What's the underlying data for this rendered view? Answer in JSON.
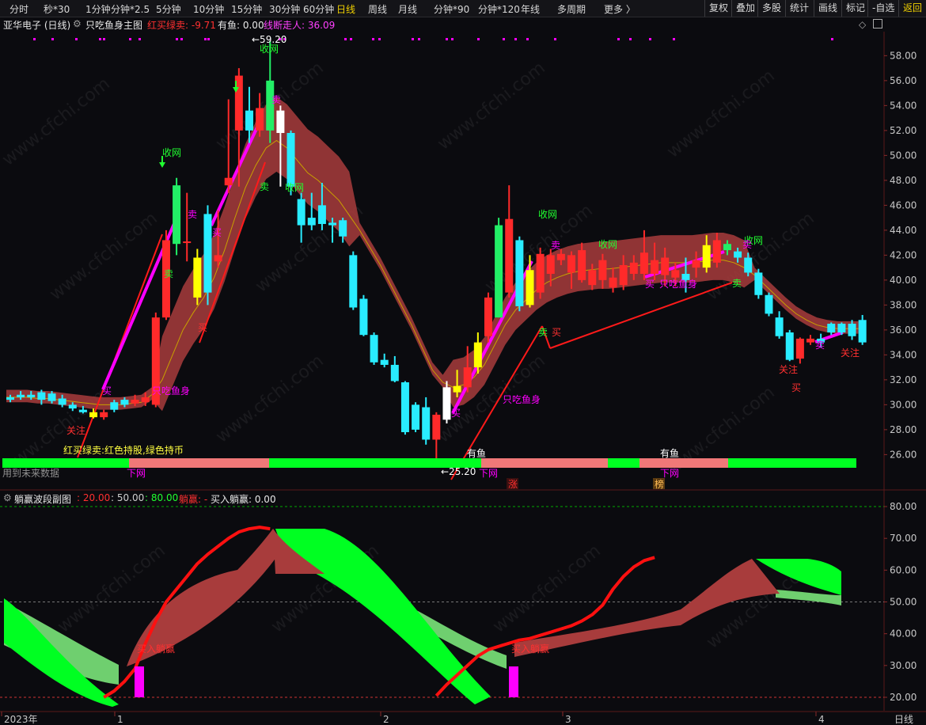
{
  "toolbar": {
    "tabs": [
      "分时",
      "秒*30",
      "1分钟",
      "分钟*2.5",
      "5分钟",
      "10分钟",
      "15分钟",
      "30分钟",
      "60分钟",
      "日线",
      "周线",
      "月线",
      "分钟*90",
      "分钟*120",
      "年线",
      "多周期",
      "更多 〉"
    ],
    "active_tab": "日线",
    "right_buttons": [
      "复权",
      "叠加",
      "多股",
      "统计",
      "画线",
      "标记",
      "-自选",
      "返回"
    ],
    "highlight_button": "返回"
  },
  "main": {
    "stock_title": "亚华电子 (日线)",
    "indicator_name": "只吃鱼身主图",
    "hongmai_label": "红买绿卖: -9.71",
    "youyu_label": "有鱼: 0.00",
    "xianduan_label": "线断走人: 36.09",
    "hint_text": "用到未来数据",
    "legend_text": "红买绿卖:红色持股,绿色持币",
    "high_marker": "59.20",
    "low_marker": "25.20",
    "y_ticks": [
      "58.00",
      "56.00",
      "54.00",
      "52.00",
      "50.00",
      "48.00",
      "46.00",
      "44.00",
      "42.00",
      "40.00",
      "38.00",
      "36.00",
      "34.00",
      "32.00",
      "30.00",
      "28.00",
      "26.00"
    ],
    "annotations": {
      "guanzhu": "关注",
      "shouwang": "收网",
      "mai_sell": "卖",
      "mai_buy": "买",
      "zhichiyushen": "只吃鱼身",
      "youyu": "有鱼",
      "xiawang": "下网",
      "zhang": "涨",
      "bang": "榜"
    }
  },
  "sub": {
    "indicator_name": "躺赢波段副图",
    "v1": ": 20.00",
    "v2": ": 50.00",
    "v3": ": 80.00",
    "tangying": "躺赢: -",
    "buy_tangying": "买入躺赢: 0.00",
    "buy_label": "买入躺赢",
    "y_ticks": [
      "80.00",
      "70.00",
      "60.00",
      "50.00",
      "40.00",
      "30.00",
      "20.00"
    ]
  },
  "x_axis": {
    "labels": [
      "2023年",
      "1",
      "2",
      "3",
      "4"
    ],
    "period": "日线"
  },
  "watermark": "www.cfchi.com",
  "colors": {
    "up": "#ff2a2a",
    "down": "#29ecff",
    "yellow": "#ffff00",
    "green_band": "#00ff22",
    "salmon": "#f07878",
    "magenta": "#ff00ff",
    "band_red": "#a83c3c",
    "band_green": "#35c835"
  },
  "chart_data": {
    "type": "candlestick",
    "y_range": [
      25,
      59
    ],
    "candles": [
      {
        "o": 30.6,
        "c": 30.4,
        "h": 30.8,
        "l": 30.2
      },
      {
        "o": 30.8,
        "c": 30.6,
        "h": 31.1,
        "l": 30.4
      },
      {
        "o": 30.8,
        "c": 30.6,
        "h": 31.1,
        "l": 30.4
      },
      {
        "o": 31.0,
        "c": 30.4,
        "h": 31.2,
        "l": 30.0
      },
      {
        "o": 30.9,
        "c": 30.3,
        "h": 31.1,
        "l": 30.1
      },
      {
        "o": 30.5,
        "c": 30.0,
        "h": 30.8,
        "l": 29.8
      },
      {
        "o": 30.0,
        "c": 29.7,
        "h": 30.2,
        "l": 29.5
      },
      {
        "o": 29.6,
        "c": 29.4,
        "h": 29.9,
        "l": 29.3
      },
      {
        "o": 29.4,
        "c": 29.0,
        "h": 29.7,
        "l": 28.9
      },
      {
        "o": 29.0,
        "c": 29.4,
        "h": 29.6,
        "l": 28.8
      },
      {
        "o": 30.2,
        "c": 29.6,
        "h": 30.4,
        "l": 29.4
      },
      {
        "o": 30.4,
        "c": 30.0,
        "h": 30.6,
        "l": 29.8
      },
      {
        "o": 30.1,
        "c": 30.4,
        "h": 30.8,
        "l": 29.9
      },
      {
        "o": 30.2,
        "c": 30.6,
        "h": 31.0,
        "l": 29.9
      },
      {
        "o": 30.0,
        "c": 37.0,
        "h": 37.4,
        "l": 29.8
      },
      {
        "o": 37.0,
        "c": 43.2,
        "h": 44.0,
        "l": 36.8
      },
      {
        "o": 47.6,
        "c": 42.9,
        "h": 48.2,
        "l": 42.0
      },
      {
        "o": 43.0,
        "c": 43.1,
        "h": 47.0,
        "l": 41.5
      },
      {
        "o": 38.6,
        "c": 41.8,
        "h": 42.5,
        "l": 38.0
      },
      {
        "o": 45.3,
        "c": 39.0,
        "h": 46.0,
        "l": 38.0
      },
      {
        "o": 41.5,
        "c": 42.0,
        "h": 45.6,
        "l": 41.0
      },
      {
        "o": 47.6,
        "c": 48.2,
        "h": 54.5,
        "l": 47.0
      },
      {
        "o": 52.0,
        "c": 56.4,
        "h": 57.0,
        "l": 47.5
      },
      {
        "o": 53.6,
        "c": 52.0,
        "h": 55.5,
        "l": 51.0
      },
      {
        "o": 52.0,
        "c": 53.8,
        "h": 55.0,
        "l": 51.5
      },
      {
        "o": 52.0,
        "c": 56.0,
        "h": 59.2,
        "l": 51.0
      },
      {
        "o": 53.6,
        "c": 51.8,
        "h": 54.0,
        "l": 47.5
      },
      {
        "o": 51.8,
        "c": 47.5,
        "h": 52.0,
        "l": 46.8
      },
      {
        "o": 46.5,
        "c": 44.4,
        "h": 47.0,
        "l": 43.0
      },
      {
        "o": 45.0,
        "c": 44.4,
        "h": 47.0,
        "l": 44.0
      },
      {
        "o": 46.0,
        "c": 44.5,
        "h": 47.8,
        "l": 44.0
      },
      {
        "o": 44.6,
        "c": 44.4,
        "h": 45.0,
        "l": 43.0
      },
      {
        "o": 44.8,
        "c": 43.5,
        "h": 45.0,
        "l": 43.0
      },
      {
        "o": 42.0,
        "c": 37.8,
        "h": 42.3,
        "l": 37.6
      },
      {
        "o": 38.5,
        "c": 35.6,
        "h": 38.8,
        "l": 35.5
      },
      {
        "o": 35.6,
        "c": 33.4,
        "h": 35.8,
        "l": 33.2
      },
      {
        "o": 33.6,
        "c": 33.2,
        "h": 34.1,
        "l": 33.0
      },
      {
        "o": 33.2,
        "c": 31.9,
        "h": 33.9,
        "l": 31.8
      },
      {
        "o": 31.8,
        "c": 27.8,
        "h": 31.9,
        "l": 27.6
      },
      {
        "o": 30.0,
        "c": 28.0,
        "h": 30.2,
        "l": 27.8
      },
      {
        "o": 29.8,
        "c": 27.2,
        "h": 30.6,
        "l": 26.8
      },
      {
        "o": 27.2,
        "c": 29.2,
        "h": 29.4,
        "l": 25.2
      },
      {
        "o": 28.8,
        "c": 31.4,
        "h": 31.9,
        "l": 28.5
      },
      {
        "o": 31.0,
        "c": 31.5,
        "h": 32.8,
        "l": 30.6
      },
      {
        "o": 31.4,
        "c": 33.0,
        "h": 34.7,
        "l": 31.0
      },
      {
        "o": 33.0,
        "c": 35.0,
        "h": 35.8,
        "l": 32.5
      },
      {
        "o": 35.5,
        "c": 38.6,
        "h": 39.0,
        "l": 35.0
      },
      {
        "o": 37.0,
        "c": 44.4,
        "h": 45.0,
        "l": 37.0
      },
      {
        "o": 39.0,
        "c": 44.9,
        "h": 47.6,
        "l": 38.6
      },
      {
        "o": 43.2,
        "c": 37.9,
        "h": 43.5,
        "l": 37.5
      },
      {
        "o": 40.8,
        "c": 38.0,
        "h": 42.0,
        "l": 37.8
      },
      {
        "o": 39.0,
        "c": 42.1,
        "h": 42.6,
        "l": 38.5
      },
      {
        "o": 40.5,
        "c": 42.0,
        "h": 42.5,
        "l": 39.5
      },
      {
        "o": 41.6,
        "c": 42.1,
        "h": 42.5,
        "l": 41.2
      },
      {
        "o": 40.6,
        "c": 42.0,
        "h": 42.3,
        "l": 39.3
      },
      {
        "o": 40.0,
        "c": 42.4,
        "h": 43.0,
        "l": 39.8
      },
      {
        "o": 39.6,
        "c": 40.8,
        "h": 41.3,
        "l": 39.2
      },
      {
        "o": 40.0,
        "c": 41.6,
        "h": 42.1,
        "l": 39.3
      },
      {
        "o": 39.4,
        "c": 40.2,
        "h": 41.0,
        "l": 39.0
      },
      {
        "o": 39.6,
        "c": 41.2,
        "h": 42.0,
        "l": 39.2
      },
      {
        "o": 40.5,
        "c": 41.4,
        "h": 42.0,
        "l": 40.0
      },
      {
        "o": 40.5,
        "c": 42.2,
        "h": 44.0,
        "l": 40.0
      },
      {
        "o": 40.5,
        "c": 41.6,
        "h": 43.0,
        "l": 40.0
      },
      {
        "o": 40.4,
        "c": 41.8,
        "h": 42.6,
        "l": 39.5
      },
      {
        "o": 40.2,
        "c": 40.8,
        "h": 41.4,
        "l": 39.5
      },
      {
        "o": 40.5,
        "c": 40.0,
        "h": 41.8,
        "l": 39.0
      },
      {
        "o": 41.0,
        "c": 41.6,
        "h": 42.3,
        "l": 40.2
      },
      {
        "o": 41.0,
        "c": 42.8,
        "h": 43.6,
        "l": 40.6
      },
      {
        "o": 41.4,
        "c": 43.2,
        "h": 43.8,
        "l": 41.0
      },
      {
        "o": 42.9,
        "c": 42.4,
        "h": 43.2,
        "l": 42.0
      },
      {
        "o": 42.3,
        "c": 41.8,
        "h": 42.6,
        "l": 41.4
      },
      {
        "o": 41.8,
        "c": 40.6,
        "h": 42.2,
        "l": 40.3
      },
      {
        "o": 40.6,
        "c": 38.8,
        "h": 40.9,
        "l": 38.5
      },
      {
        "o": 38.8,
        "c": 37.3,
        "h": 39.0,
        "l": 37.1
      },
      {
        "o": 37.0,
        "c": 35.5,
        "h": 37.5,
        "l": 35.3
      },
      {
        "o": 35.8,
        "c": 33.6,
        "h": 36.0,
        "l": 33.5
      },
      {
        "o": 33.7,
        "c": 35.3,
        "h": 35.4,
        "l": 33.3
      },
      {
        "o": 35.0,
        "c": 35.3,
        "h": 35.6,
        "l": 34.8
      },
      {
        "o": 35.3,
        "c": 35.0,
        "h": 35.7,
        "l": 34.6
      },
      {
        "o": 36.5,
        "c": 35.8,
        "h": 36.6,
        "l": 35.6
      },
      {
        "o": 36.5,
        "c": 35.8,
        "h": 36.6,
        "l": 35.6
      },
      {
        "o": 36.5,
        "c": 35.5,
        "h": 36.8,
        "l": 35.2
      },
      {
        "o": 36.8,
        "c": 35.0,
        "h": 37.2,
        "l": 34.8
      }
    ],
    "ma_line": [
      30.6,
      30.6,
      30.6,
      30.5,
      30.5,
      30.4,
      30.3,
      30.2,
      30.1,
      30.0,
      30.0,
      30.0,
      30.1,
      30.2,
      30.8,
      32.0,
      34.0,
      36.0,
      37.4,
      38.6,
      40.2,
      42.4,
      45.0,
      47.4,
      49.2,
      50.6,
      51.2,
      50.6,
      49.6,
      48.6,
      48.0,
      47.2,
      46.4,
      45.2,
      44.0,
      42.6,
      41.2,
      39.6,
      38.0,
      36.4,
      34.6,
      32.8,
      31.8,
      31.4,
      31.6,
      32.2,
      33.2,
      34.8,
      36.4,
      37.6,
      38.4,
      39.2,
      39.8,
      40.2,
      40.5,
      40.7,
      40.8,
      40.9,
      40.9,
      41.0,
      41.1,
      41.2,
      41.3,
      41.4,
      41.4,
      41.4,
      41.4,
      41.5,
      41.6,
      41.6,
      41.4,
      41.0,
      40.4,
      39.6,
      38.8,
      38.0,
      37.3,
      36.8,
      36.4,
      36.2,
      36.1,
      36.1,
      36.1
    ],
    "sub_series": {
      "red_line": [
        null,
        null,
        null,
        null,
        null,
        null,
        null,
        null,
        null,
        20.0,
        22.0,
        25.0,
        29.0,
        37.0,
        44.0,
        50.0,
        54.0,
        58.0,
        62.0,
        65.0,
        67.5,
        70.0,
        72.0,
        73.0,
        73.5,
        73.0,
        null,
        null,
        null,
        null,
        null,
        null,
        null,
        null,
        null,
        null,
        null,
        null,
        null,
        null,
        null,
        20.5,
        24.0,
        27.0,
        30.0,
        33.0,
        35.0,
        36.0,
        37.0,
        38.0,
        38.5,
        39.5,
        40.5,
        41.5,
        42.5,
        44.0,
        46.0,
        49.0,
        54.0,
        58.0,
        61.0,
        63.0,
        64.0
      ]
    }
  }
}
